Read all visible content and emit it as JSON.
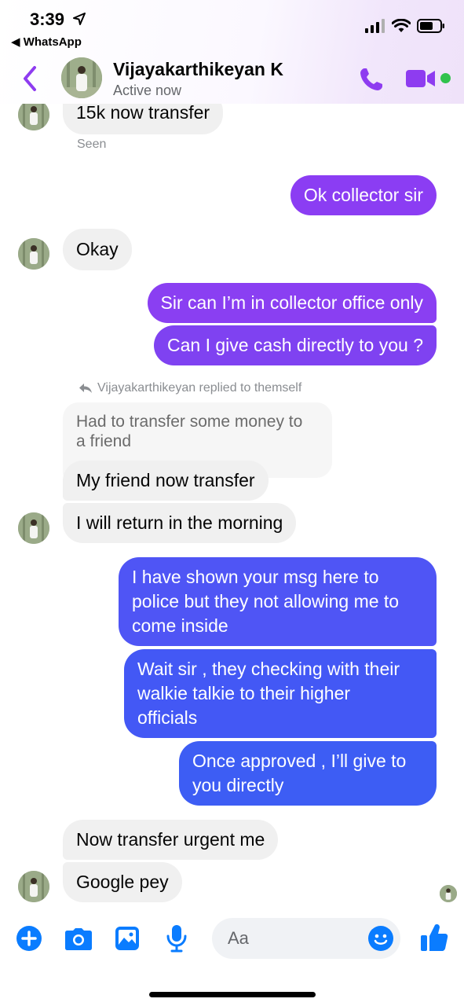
{
  "status_bar": {
    "time": "3:39",
    "back_app": "◀ WhatsApp"
  },
  "header": {
    "contact_name": "Vijayakarthikeyan K",
    "contact_status": "Active now"
  },
  "colors": {
    "accent": "#8e3cf0",
    "outgoing_top": "#8b3df3",
    "outgoing_bottom": "#3d5bf6",
    "online": "#31c24d"
  },
  "messages": {
    "m0": "15k now transfer",
    "seen": "Seen",
    "m1": "Ok collector sir",
    "m2": "Okay",
    "m3": "Sir can I’m in collector office only",
    "m4": "Can I give cash directly to you ?",
    "reply_note": "Vijayakarthikeyan replied to themself",
    "quoted": "Had to transfer some money to\na friend",
    "m5": "My friend now transfer",
    "m6": "I will return in the morning",
    "m7": "I have shown your msg here to\npolice but they not allowing me to\ncome inside",
    "m8": "Wait sir , they checking with their\nwalkie talkie to their higher\nofficials",
    "m9": "Once approved , I’ll give to\nyou directly",
    "m10": "Now transfer urgent me",
    "m11": "Google pey"
  },
  "composer": {
    "placeholder": "Aa"
  },
  "icons": [
    "back-chevron-icon",
    "phone-icon",
    "video-camera-icon",
    "plus-icon",
    "camera-icon",
    "gallery-icon",
    "microphone-icon",
    "emoji-icon",
    "thumbs-up-icon"
  ]
}
